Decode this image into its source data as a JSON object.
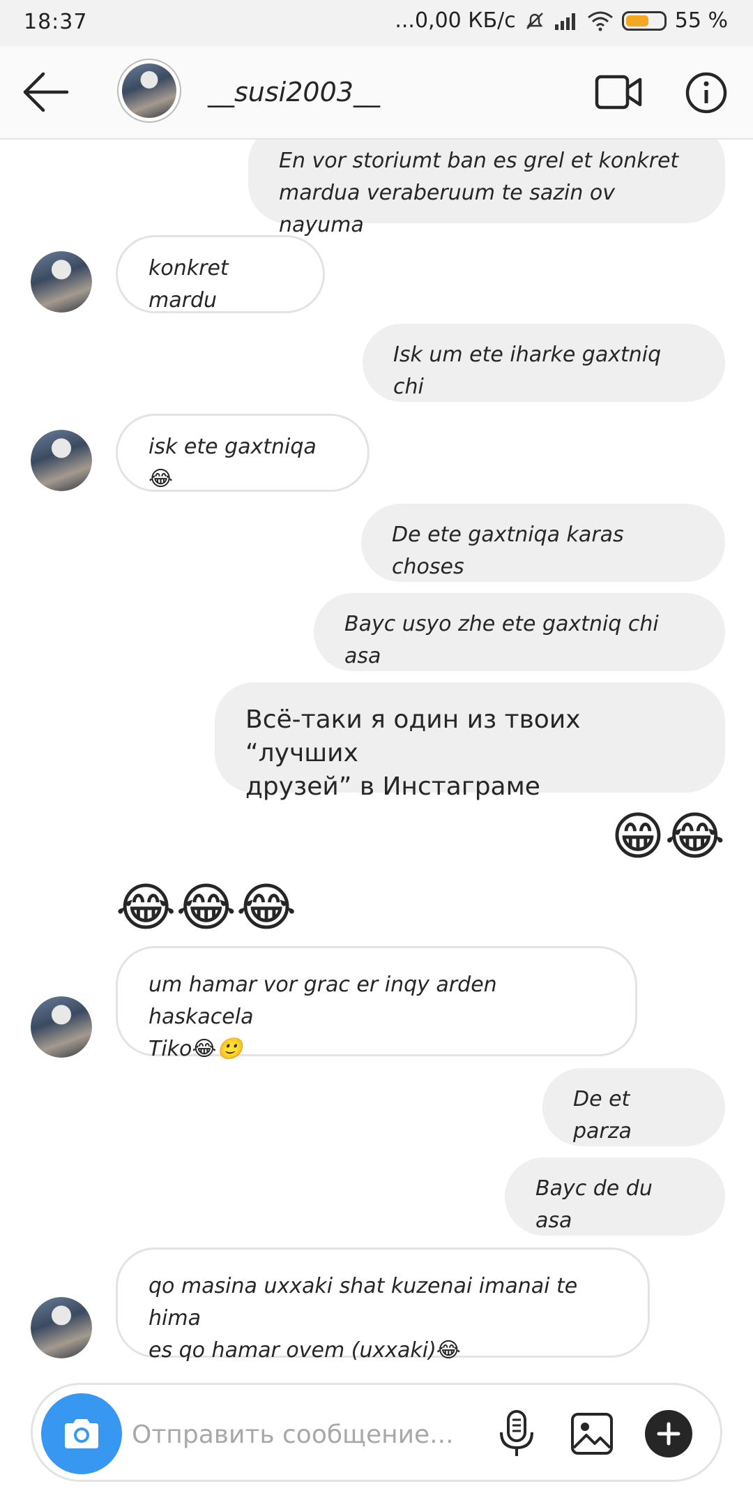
{
  "status_bar": {
    "time": "18:37",
    "network": "...0,00 КБ/с",
    "battery": "55 %"
  },
  "header": {
    "username": "__susi2003__",
    "back_icon": "arrow-left-icon",
    "video_icon": "video-camera-icon",
    "info_icon": "info-icon"
  },
  "messages": [
    {
      "dir": "out",
      "text": "En vor storiumt ban es grel et konkret\nmardua veraberuum te sazin ov nayuma"
    },
    {
      "dir": "in",
      "text": "konkret mardu"
    },
    {
      "dir": "out",
      "text": "Isk um ete iharke gaxtniq chi"
    },
    {
      "dir": "in",
      "text": "isk ete gaxtniqa😂"
    },
    {
      "dir": "out",
      "text": "De ete gaxtniqa karas choses"
    },
    {
      "dir": "out",
      "text": "Bayc usyo zhe ete gaxtniq chi asa"
    },
    {
      "dir": "out",
      "text": "Всё-таки я один из твоих “лучших\nдрузей” в Инстаграме"
    },
    {
      "dir": "out",
      "text": "😁😂"
    },
    {
      "dir": "in",
      "text": "😂😂😂"
    },
    {
      "dir": "in",
      "text": "um hamar vor grac er inqy arden haskacela\nTiko😂🙂"
    },
    {
      "dir": "out",
      "text": "De et parza"
    },
    {
      "dir": "out",
      "text": "Bayc de du asa"
    },
    {
      "dir": "in",
      "text": "qo masina uxxaki shat kuzenai imanai te hima\nes qo hamar ovem (uxxaki)😂"
    }
  ],
  "composer": {
    "placeholder": "Отправить сообщение...",
    "camera_icon": "camera-icon",
    "mic_icon": "microphone-icon",
    "gallery_icon": "gallery-icon",
    "plus_icon": "plus-icon"
  },
  "colors": {
    "accent": "#3897f0",
    "outgoing_bubble": "#efefef",
    "incoming_border": "#e3e3e3"
  }
}
